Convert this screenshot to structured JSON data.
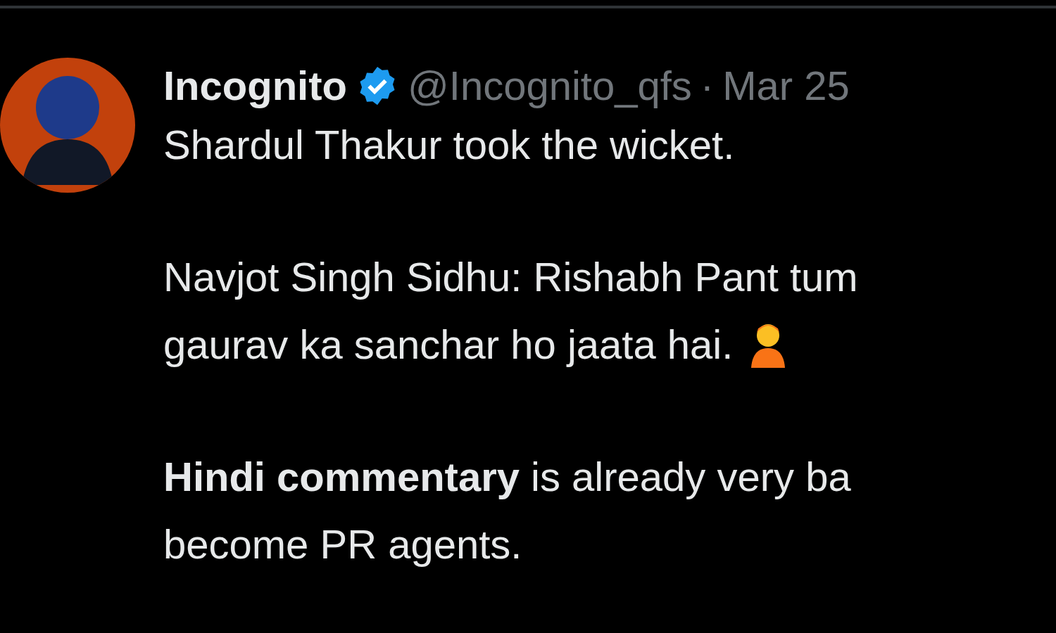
{
  "tweet": {
    "author": {
      "name": "Incognito",
      "verified": true,
      "handle": "@Incognito_qfs",
      "separator": "·",
      "date": "Mar 25"
    },
    "paragraphs": [
      {
        "lines": [
          {
            "text": "Shardul Thakur took the wicket."
          }
        ]
      },
      {
        "lines": [
          {
            "text": "Navjot Singh Sidhu: Rishabh Pant tum"
          },
          {
            "text": "gaurav ka sanchar ho jaata hai.",
            "emoji": true
          }
        ]
      },
      {
        "lines": [
          {
            "text": "**Hindi commentary** is already very ba"
          },
          {
            "text": "become PR agents."
          }
        ]
      }
    ]
  }
}
